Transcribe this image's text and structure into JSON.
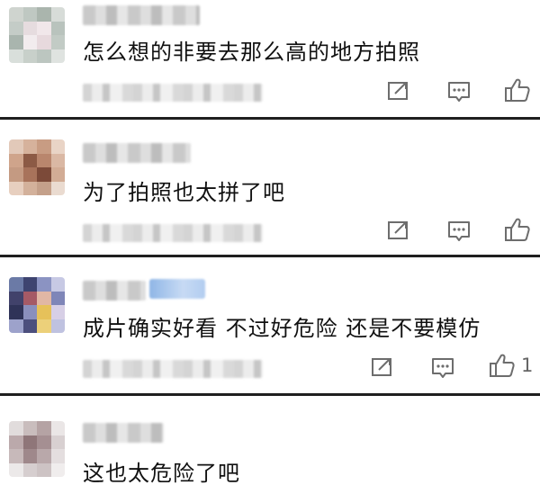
{
  "comments": [
    {
      "text": "怎么想的非要去那么高的地方拍照",
      "like_count": "",
      "avatar_colors": [
        "#cfd4cf",
        "#bfc8c2",
        "#aab5ad",
        "#d7dcd8",
        "#c4ccc7",
        "#e6dcdf",
        "#f1e7ea",
        "#b9c3bd",
        "#a9b5ae",
        "#f2ecee",
        "#e7d9dd",
        "#c2cbc5",
        "#d9dfdb",
        "#c8d0ca",
        "#bcc6c0",
        "#dfe3e0"
      ]
    },
    {
      "text": "为了拍照也太拼了吧",
      "like_count": "",
      "avatar_colors": [
        "#e2c9b9",
        "#d6b29c",
        "#c89c83",
        "#e9d4c6",
        "#cfa48b",
        "#8c5a45",
        "#b9866d",
        "#dab8a4",
        "#c49a82",
        "#a8735b",
        "#7c4a39",
        "#d2ac95",
        "#e7cfbf",
        "#d3b19b",
        "#c4a08a",
        "#eadbd0"
      ]
    },
    {
      "text": "成片确实好看 不过好危险 还是不要模仿",
      "like_count": "1",
      "avatar_colors": [
        "#6b7aa6",
        "#3e4470",
        "#8b93c2",
        "#c7c9e4",
        "#41426b",
        "#a55a66",
        "#e1b7a5",
        "#7f86b8",
        "#2f3358",
        "#8a8fbc",
        "#e6c15a",
        "#d7cfe6",
        "#9da2cb",
        "#4c4f7d",
        "#ecd07a",
        "#bfc2e0"
      ]
    },
    {
      "text": "这也太危险了吧",
      "like_count": "",
      "avatar_colors": [
        "#e1dcdc",
        "#c9bdbd",
        "#b5a3a4",
        "#eae6e6",
        "#bba9ab",
        "#8f7679",
        "#a58f92",
        "#d8d0d1",
        "#c7b9ba",
        "#9f888b",
        "#b9a8aa",
        "#e4dedf",
        "#ece9e9",
        "#d6cecf",
        "#cdc3c4",
        "#f0eded"
      ]
    }
  ],
  "icons": {
    "share": "share-icon",
    "reply": "reply-icon",
    "like": "thumbs-up-icon"
  },
  "colors": {
    "divider": "#1f1f1f",
    "text": "#111111",
    "icon": "#6d6d6d"
  }
}
